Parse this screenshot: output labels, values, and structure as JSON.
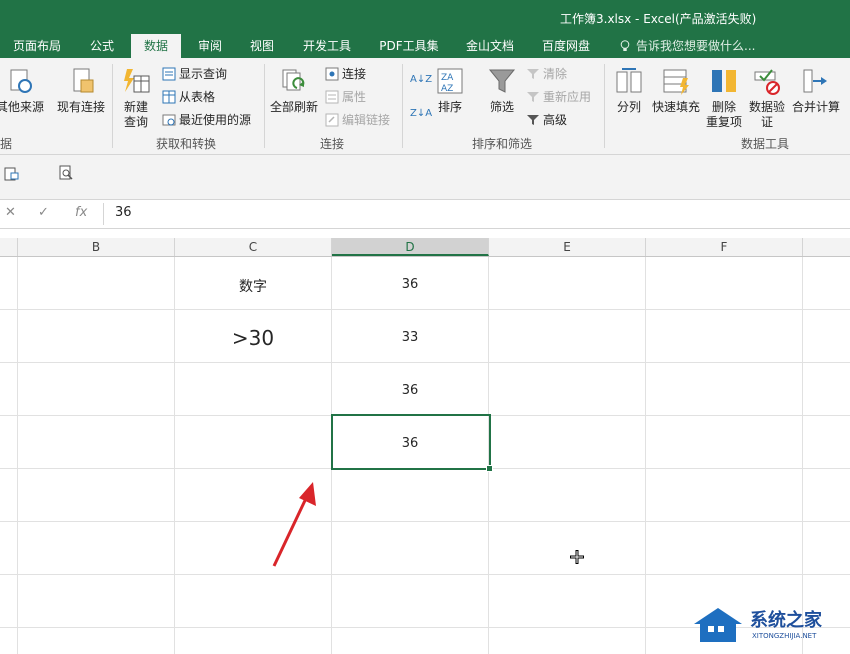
{
  "window": {
    "title": "工作簿3.xlsx - Excel(产品激活失败)"
  },
  "tabs": [
    {
      "label": "页面布局"
    },
    {
      "label": "公式"
    },
    {
      "label": "数据",
      "active": true
    },
    {
      "label": "审阅"
    },
    {
      "label": "视图"
    },
    {
      "label": "开发工具"
    },
    {
      "label": "PDF工具集"
    },
    {
      "label": "金山文档"
    },
    {
      "label": "百度网盘"
    }
  ],
  "tellme": {
    "text": "告诉我您想要做什么..."
  },
  "ribbon": {
    "get_transform": {
      "other_sources": "其他来源",
      "existing_connections": "现有连接",
      "new_query_line1": "新建",
      "new_query_line2": "查询",
      "show_queries": "显示查询",
      "from_table": "从表格",
      "recent_sources": "最近使用的源",
      "group_label": "获取和转换",
      "left_group_fragment": "据"
    },
    "connections": {
      "refresh_all": "全部刷新",
      "connections": "连接",
      "properties": "属性",
      "edit_links": "编辑链接",
      "group_label": "连接"
    },
    "sort_filter": {
      "sort": "排序",
      "filter": "筛选",
      "clear": "清除",
      "reapply": "重新应用",
      "advanced": "高级",
      "group_label": "排序和筛选"
    },
    "data_tools": {
      "text_to_columns": "分列",
      "flash_fill": "快速填充",
      "remove_duplicates_line1": "删除",
      "remove_duplicates_line2": "重复项",
      "data_validation_line1": "数据验",
      "data_validation_line2": "证",
      "consolidate": "合并计算",
      "group_label": "数据工具"
    }
  },
  "formula_bar": {
    "value": "36",
    "fx": "fx"
  },
  "columns": [
    "B",
    "C",
    "D",
    "E",
    "F"
  ],
  "cells": {
    "c1": "数字",
    "c2": ">30",
    "d1": "36",
    "d2": "33",
    "d3": "36",
    "d4": "36"
  },
  "colors": {
    "accent": "#217346",
    "arrow": "#d9252a"
  },
  "watermark": {
    "text": "系统之家",
    "url": "XITONGZHIJIA.NET"
  }
}
